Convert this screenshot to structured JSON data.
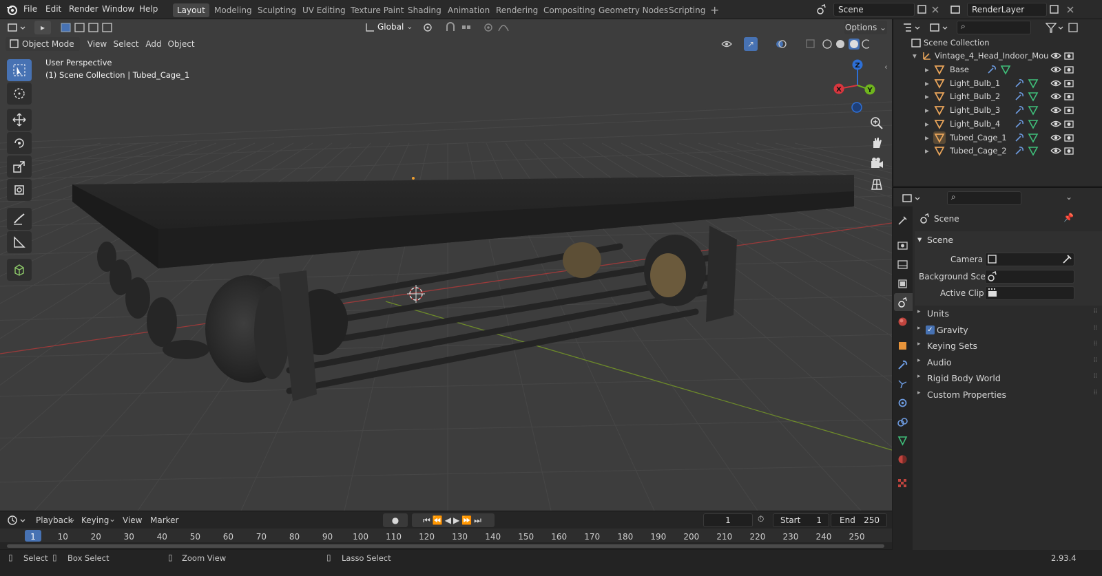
{
  "topbar": {
    "menus": [
      "File",
      "Edit",
      "Render",
      "Window",
      "Help"
    ],
    "workspaces": [
      "Layout",
      "Modeling",
      "Sculpting",
      "UV Editing",
      "Texture Paint",
      "Shading",
      "Animation",
      "Rendering",
      "Compositing",
      "Geometry Nodes",
      "Scripting"
    ],
    "active_workspace": "Layout",
    "scene_name": "Scene",
    "view_layer_name": "RenderLayer"
  },
  "viewport": {
    "transform_orientation": "Global",
    "options_label": "Options",
    "mode_label": "Object Mode",
    "header_menus": [
      "View",
      "Select",
      "Add",
      "Object"
    ],
    "overlay_line1": "User Perspective",
    "overlay_line2": "(1) Scene Collection | Tubed_Cage_1",
    "gizmo_axes": [
      "X",
      "Y",
      "Z"
    ],
    "colors": {
      "x_axis": "#d9363e",
      "y_axis": "#6fb51d",
      "z_axis": "#2d6fd6",
      "grid": "#464646",
      "background": "#3d3d3d"
    }
  },
  "timeline": {
    "menus": [
      "Playback",
      "Keying",
      "View",
      "Marker"
    ],
    "current_frame": "1",
    "start_label": "Start",
    "start_value": "1",
    "end_label": "End",
    "end_value": "250",
    "ruler": [
      "1",
      "10",
      "20",
      "30",
      "40",
      "50",
      "60",
      "70",
      "80",
      "90",
      "100",
      "110",
      "120",
      "130",
      "140",
      "150",
      "160",
      "170",
      "180",
      "190",
      "200",
      "210",
      "220",
      "230",
      "240",
      "250"
    ]
  },
  "statusbar": {
    "items": [
      "Select",
      "Box Select",
      "Zoom View",
      "Lasso Select"
    ],
    "version": "2.93.4"
  },
  "outliner": {
    "root": "Scene Collection",
    "parent": "Vintage_4_Head_Indoor_Mou",
    "children": [
      "Base",
      "Light_Bulb_1",
      "Light_Bulb_2",
      "Light_Bulb_3",
      "Light_Bulb_4",
      "Tubed_Cage_1",
      "Tubed_Cage_2"
    ],
    "active_child": "Tubed_Cage_1"
  },
  "properties": {
    "context_title": "Scene",
    "panel_scene": "Scene",
    "camera_label": "Camera",
    "background_label": "Background Sce...",
    "active_clip_label": "Active Clip",
    "panels": [
      "Units",
      "Gravity",
      "Keying Sets",
      "Audio",
      "Rigid Body World",
      "Custom Properties"
    ],
    "gravity_checked": true
  },
  "colors": {
    "accent": "#4772b3",
    "object_orange": "#e8a45a"
  }
}
